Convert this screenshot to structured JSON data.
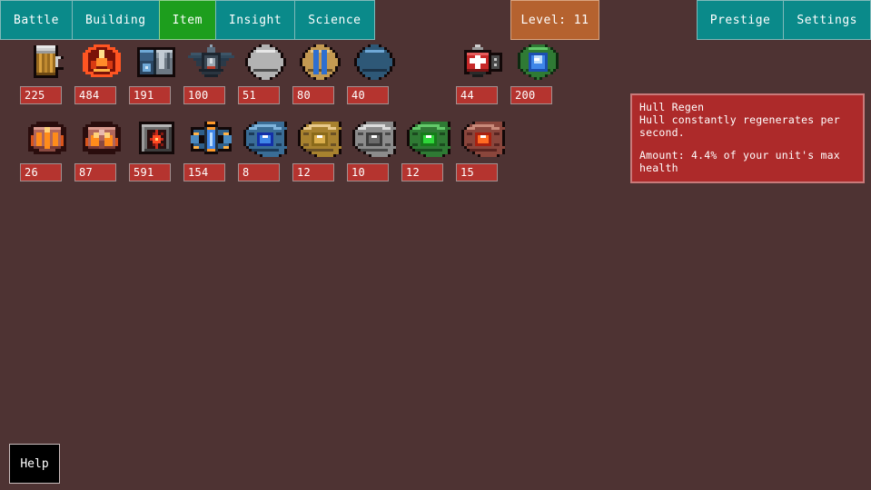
{
  "colors": {
    "background": "#4e3333",
    "tab": "#0a8a8a",
    "tab_active": "#1d9e1d",
    "level_box": "#b5622f",
    "badge": "#b5342f",
    "tooltip_bg": "#ad2a2a",
    "tooltip_border": "#c97a7a",
    "help_bg": "#000000"
  },
  "header": {
    "left_tabs": [
      {
        "label": "Battle",
        "active": false,
        "name": "tab-battle"
      },
      {
        "label": "Building",
        "active": false,
        "name": "tab-building"
      },
      {
        "label": "Item",
        "active": true,
        "name": "tab-item"
      },
      {
        "label": "Insight",
        "active": false,
        "name": "tab-insight"
      },
      {
        "label": "Science",
        "active": false,
        "name": "tab-science"
      }
    ],
    "level_label": "Level: 11",
    "right_tabs": [
      {
        "label": "Prestige",
        "active": false,
        "name": "tab-prestige"
      },
      {
        "label": "Settings",
        "active": false,
        "name": "tab-settings"
      }
    ]
  },
  "items": {
    "rows": [
      {
        "slots": [
          {
            "icon": "beer-mug-icon",
            "count": "225",
            "empty": false
          },
          {
            "icon": "red-crest-emblem-icon",
            "count": "484",
            "empty": false
          },
          {
            "icon": "blue-machine-module-icon",
            "count": "191",
            "empty": false
          },
          {
            "icon": "dark-winged-device-icon",
            "count": "100",
            "empty": false
          },
          {
            "icon": "metal-capsule-icon",
            "count": "51",
            "empty": false
          },
          {
            "icon": "blue-rod-capsule-icon",
            "count": "80",
            "empty": false
          },
          {
            "icon": "blue-stone-egg-icon",
            "count": "40",
            "empty": false
          },
          {
            "icon": "empty-slot",
            "count": "",
            "empty": true
          },
          {
            "icon": "medkit-icon",
            "count": "44",
            "empty": false
          },
          {
            "icon": "green-blue-orb-icon",
            "count": "200",
            "empty": false
          }
        ]
      },
      {
        "slots": [
          {
            "icon": "red-carapace-icon",
            "count": "26",
            "empty": false
          },
          {
            "icon": "red-mandible-shell-icon",
            "count": "87",
            "empty": false
          },
          {
            "icon": "red-star-shield-icon",
            "count": "591",
            "empty": false
          },
          {
            "icon": "blue-mech-core-icon",
            "count": "154",
            "empty": false
          },
          {
            "icon": "blue-gem-icon",
            "count": "8",
            "empty": false
          },
          {
            "icon": "gold-gem-icon",
            "count": "12",
            "empty": false
          },
          {
            "icon": "silver-gem-icon",
            "count": "10",
            "empty": false
          },
          {
            "icon": "green-gem-icon",
            "count": "12",
            "empty": false
          },
          {
            "icon": "red-gem-icon",
            "count": "15",
            "empty": false
          }
        ]
      }
    ]
  },
  "tooltip": {
    "title": "Hull Regen",
    "description": "Hull constantly regenerates per second.",
    "amount": "Amount: 4.4% of your unit's max health"
  },
  "help": {
    "label": "Help"
  }
}
